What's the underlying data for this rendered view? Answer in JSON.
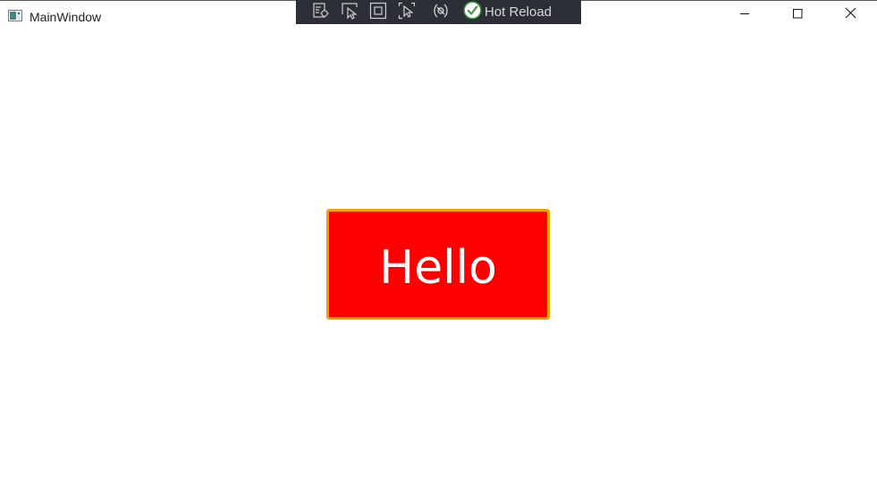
{
  "window": {
    "title": "MainWindow",
    "app_icon": "app-window-icon",
    "caption_buttons": {
      "minimize_icon": "minimize-icon",
      "maximize_icon": "maximize-icon",
      "close_icon": "close-icon"
    }
  },
  "devbar": {
    "tools": [
      {
        "icon": "live-visual-tree-icon"
      },
      {
        "icon": "select-element-icon"
      },
      {
        "icon": "display-layout-adorners-icon"
      },
      {
        "icon": "track-focused-element-icon"
      },
      {
        "icon": "binding-failures-icon"
      }
    ],
    "hot_reload": {
      "icon": "check-circle-icon",
      "label": "Hot Reload",
      "status_color": "#5cb85c"
    },
    "background": "#2d2f36"
  },
  "content": {
    "hello_button": {
      "label": "Hello",
      "background": "#ff0000",
      "border_color": "#f5a000",
      "text_color": "#ffffff"
    }
  }
}
